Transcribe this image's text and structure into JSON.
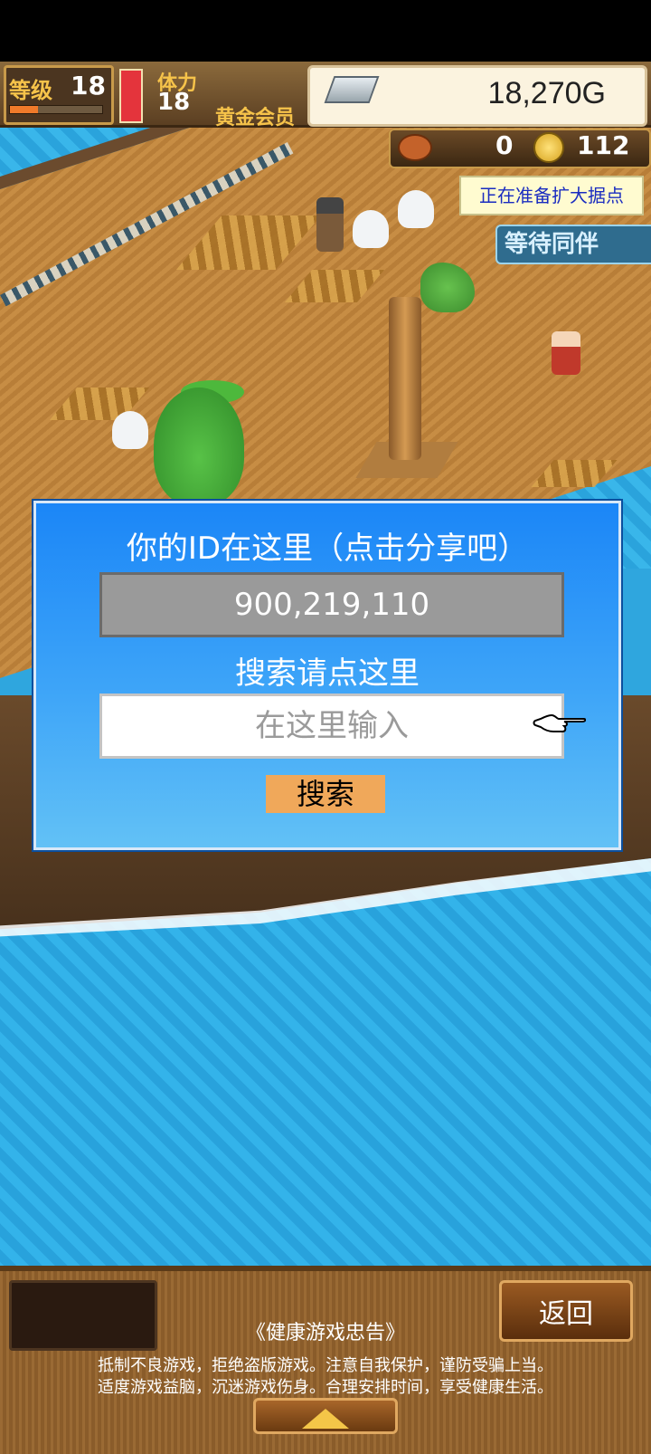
{
  "hud": {
    "level_label": "等级",
    "level_value": "18",
    "level_progress": 0.3,
    "stamina_label": "体力",
    "stamina_value": "18",
    "stamina_level": 1.0,
    "member_label": "黄金会员",
    "gold": "18,270G",
    "meat_count": "0",
    "coin_count": "112",
    "expand_notice": "正在准备扩大据点",
    "wait_label": "等待同伴"
  },
  "dialog": {
    "title": "你的ID在这里（点击分享吧）",
    "player_id": "900,219,110",
    "search_hint": "搜索请点这里",
    "search_placeholder": "在这里输入",
    "search_button": "搜索"
  },
  "bottom": {
    "back_button": "返回",
    "notice_title": "《健康游戏忠告》",
    "notice_line1": "抵制不良游戏，拒绝盗版游戏。注意自我保护，谨防受骗上当。",
    "notice_line2": "适度游戏益脑，沉迷游戏伤身。合理安排时间，享受健康生活。"
  },
  "icons": [
    "silver-ingot-icon",
    "meat-icon",
    "coin-icon",
    "pointing-hand-icon",
    "up-arrow-icon"
  ],
  "colors": {
    "dialog_blue": "#1b86f7",
    "button_orange": "#f0a85a",
    "notice_text": "#1a2cc0"
  }
}
